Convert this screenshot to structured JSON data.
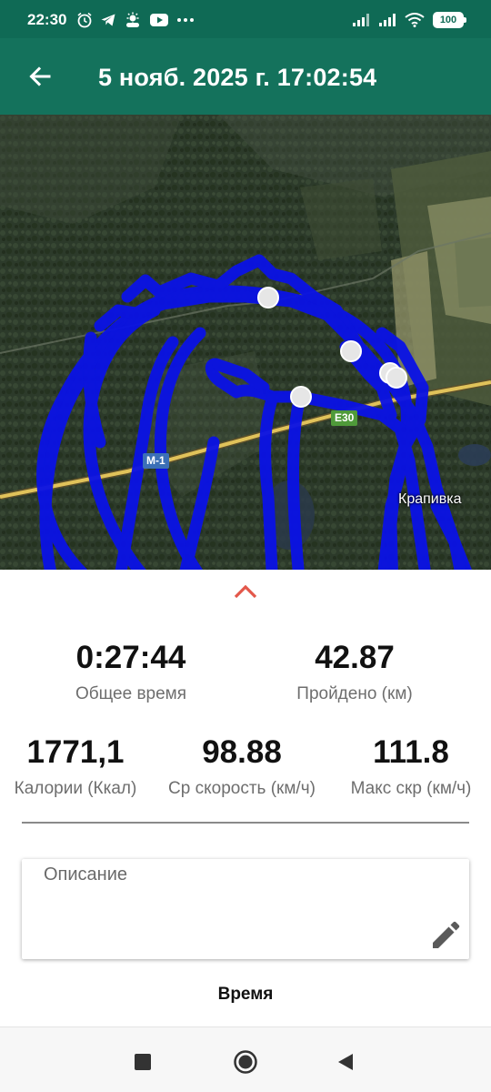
{
  "status_bar": {
    "time": "22:30",
    "left_icons": [
      "alarm-icon",
      "telegram-icon",
      "weather-icon",
      "youtube-icon",
      "more-dots-icon"
    ],
    "right_icons": [
      "signal-icon",
      "signal-icon",
      "wifi-icon",
      "battery-icon"
    ],
    "battery": "100"
  },
  "app_bar": {
    "title": "5 нояб. 2025 г. 17:02:54",
    "back_icon": "arrow-back-icon",
    "color": "#14725c"
  },
  "map": {
    "road_labels": [
      "M-1",
      "E30"
    ],
    "place_label": "Крапивка",
    "track_color": "#0a12e6"
  },
  "stats": {
    "expand_icon": "chevron-up-icon",
    "accent": "#e3574a",
    "total_time": {
      "value": "0:27:44",
      "label": "Общее время"
    },
    "distance": {
      "value": "42.87",
      "label": "Пройдено (км)"
    },
    "calories": {
      "value": "1771,1",
      "label": "Калории (Ккал)"
    },
    "avg_speed": {
      "value": "98.88",
      "label": "Ср скорость (км/ч)"
    },
    "max_speed": {
      "value": "111.8",
      "label": "Макс скр (км/ч)"
    }
  },
  "description": {
    "placeholder": "Описание",
    "edit_icon": "pencil-icon"
  },
  "time_section": {
    "label": "Время"
  },
  "nav_bar": {
    "items": [
      "recents-square-icon",
      "home-circle-icon",
      "back-triangle-icon"
    ]
  }
}
